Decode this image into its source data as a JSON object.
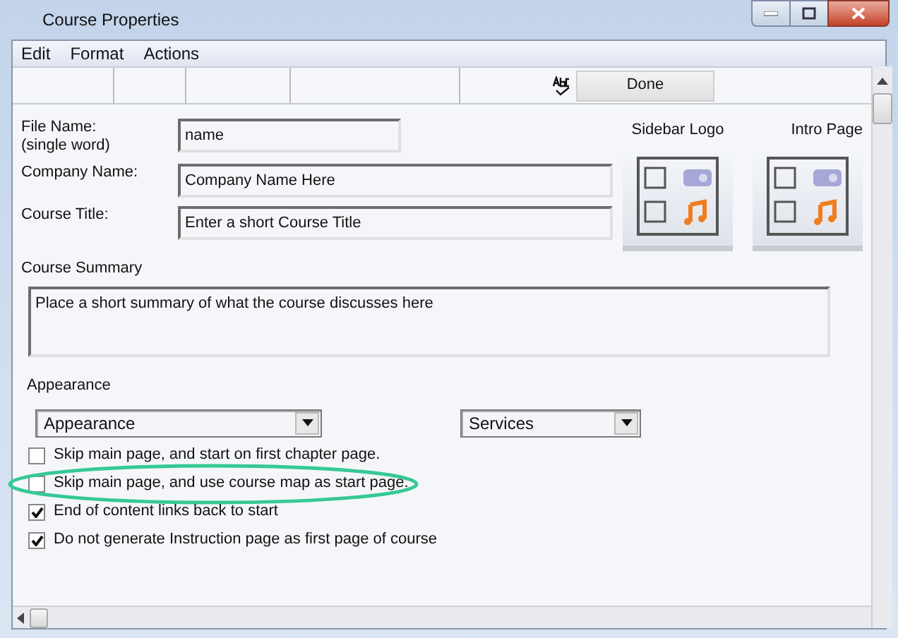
{
  "window": {
    "title": "Course Properties"
  },
  "menu": [
    "Edit",
    "Format",
    "Actions"
  ],
  "toolbar": {
    "done": "Done"
  },
  "fields": [
    {
      "label": "File Name:\n(single word)",
      "value": "name",
      "wide": false
    },
    {
      "label": "Company Name:",
      "value": "Company Name Here",
      "wide": true
    },
    {
      "label": "Course Title:",
      "value": "Enter a short Course Title",
      "wide": true
    }
  ],
  "images": [
    {
      "label": "Sidebar Logo"
    },
    {
      "label": "Intro Page"
    }
  ],
  "summary": {
    "label": "Course Summary",
    "value": "Place a short summary of what the course discusses here"
  },
  "appearance": {
    "label": "Appearance",
    "dropdowns": [
      {
        "value": "Appearance"
      },
      {
        "value": "Services"
      }
    ]
  },
  "options": [
    {
      "label": "Skip main page, and start on first chapter page.",
      "checked": false
    },
    {
      "label": "Skip main page, and use course map as start page.",
      "checked": false,
      "highlighted": true
    },
    {
      "label": "End of content links back to start",
      "checked": true
    },
    {
      "label": "Do not generate Instruction page as first page of course",
      "checked": true
    }
  ]
}
